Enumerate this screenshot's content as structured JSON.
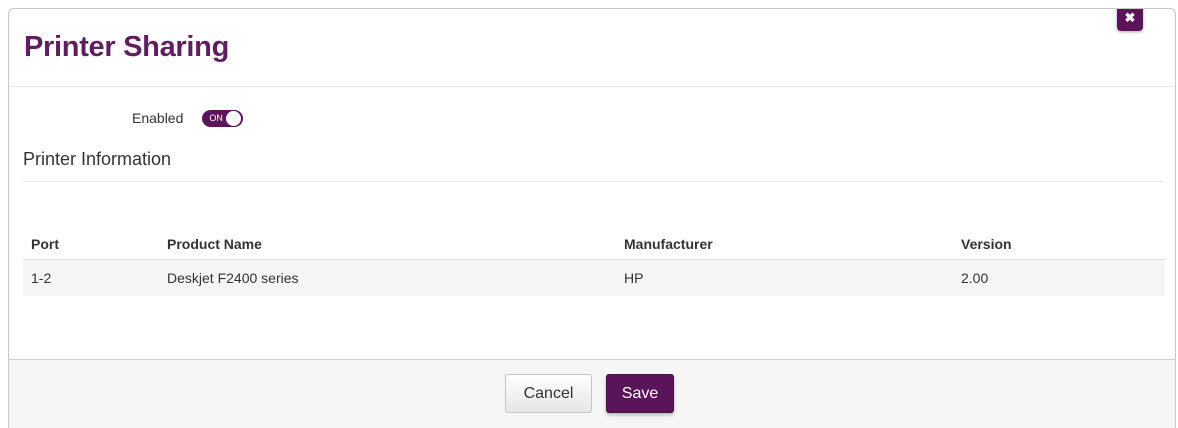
{
  "dialog": {
    "title": "Printer Sharing",
    "close_icon": "close-icon"
  },
  "settings": {
    "enabled_label": "Enabled",
    "toggle_text": "ON",
    "enabled": true
  },
  "printer_info": {
    "section_title": "Printer Information",
    "columns": [
      "Port",
      "Product Name",
      "Manufacturer",
      "Version"
    ],
    "rows": [
      [
        "1-2",
        "Deskjet F2400 series",
        "HP",
        "2.00"
      ]
    ]
  },
  "footer": {
    "cancel_label": "Cancel",
    "save_label": "Save"
  },
  "colors": {
    "accent": "#5a1459",
    "title": "#5f1f5f"
  }
}
